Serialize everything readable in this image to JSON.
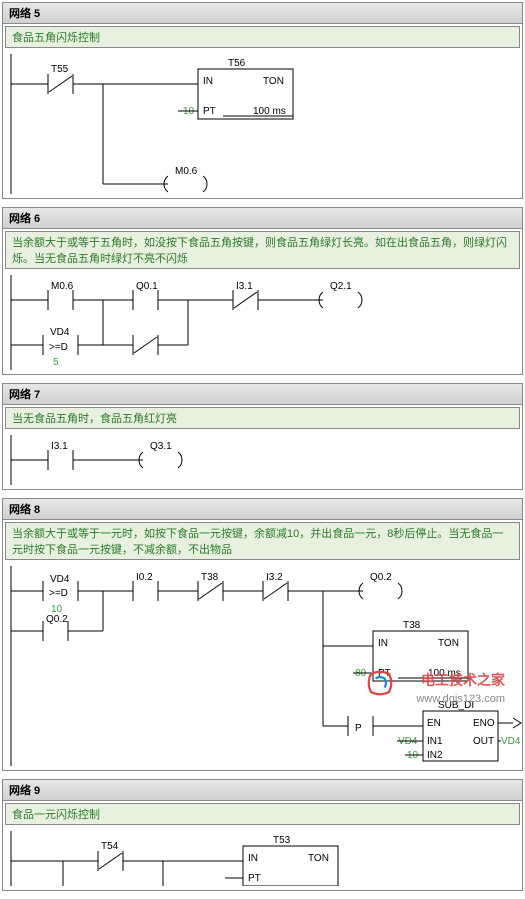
{
  "networks": [
    {
      "id": "net5",
      "title": "网络 5",
      "comment": "食品五角闪烁控制",
      "elements": {
        "contact1": "T55",
        "timer_name": "T56",
        "timer_type": "TON",
        "timer_in": "IN",
        "timer_pt": "PT",
        "timer_pt_val": "10",
        "timer_time": "100 ms",
        "coil1": "M0.6"
      }
    },
    {
      "id": "net6",
      "title": "网络 6",
      "comment": "当余额大于或等于五角时，如没按下食品五角按键，则食品五角绿灯长亮。如在出食品五角，则绿灯闪烁。当无食品五角时绿灯不亮不闪烁",
      "elements": {
        "contact1": "M0.6",
        "contact2": "Q0.1",
        "contact3": "I3.1",
        "coil1": "Q2.1",
        "cmp_var": "VD4",
        "cmp_op": ">=D",
        "cmp_val": "5"
      }
    },
    {
      "id": "net7",
      "title": "网络 7",
      "comment": "当无食品五角时，食品五角红灯亮",
      "elements": {
        "contact1": "I3.1",
        "coil1": "Q3.1"
      }
    },
    {
      "id": "net8",
      "title": "网络 8",
      "comment": "当余额大于或等于一元时，如按下食品一元按键，余额减10，并出食品一元，8秒后停止。当无食品一元时按下食品一元按键，不减余额，不出物品",
      "elements": {
        "cmp_var": "VD4",
        "cmp_op": ">=D",
        "cmp_val": "10",
        "contact2": "I0.2",
        "contact3": "T38",
        "contact4": "I3.2",
        "contact_q": "Q0.2",
        "coil1": "Q0.2",
        "timer_name": "T38",
        "timer_type": "TON",
        "timer_in": "IN",
        "timer_pt": "PT",
        "timer_pt_val": "80",
        "timer_time": "100 ms",
        "edge": "P",
        "sub_name": "SUB_DI",
        "sub_en": "EN",
        "sub_eno": "ENO",
        "sub_in1": "IN1",
        "sub_in1_val": "VD4",
        "sub_in2": "IN2",
        "sub_in2_val": "10",
        "sub_out": "OUT",
        "sub_out_val": "VD4"
      }
    },
    {
      "id": "net9",
      "title": "网络 9",
      "comment": "食品一元闪烁控制",
      "elements": {
        "contact1": "T54",
        "timer_name": "T53",
        "timer_type": "TON",
        "timer_in": "IN",
        "timer_pt": "PT"
      }
    }
  ],
  "watermark": {
    "text1": "电工技术之家",
    "text2": "www.dgjs123.com"
  }
}
